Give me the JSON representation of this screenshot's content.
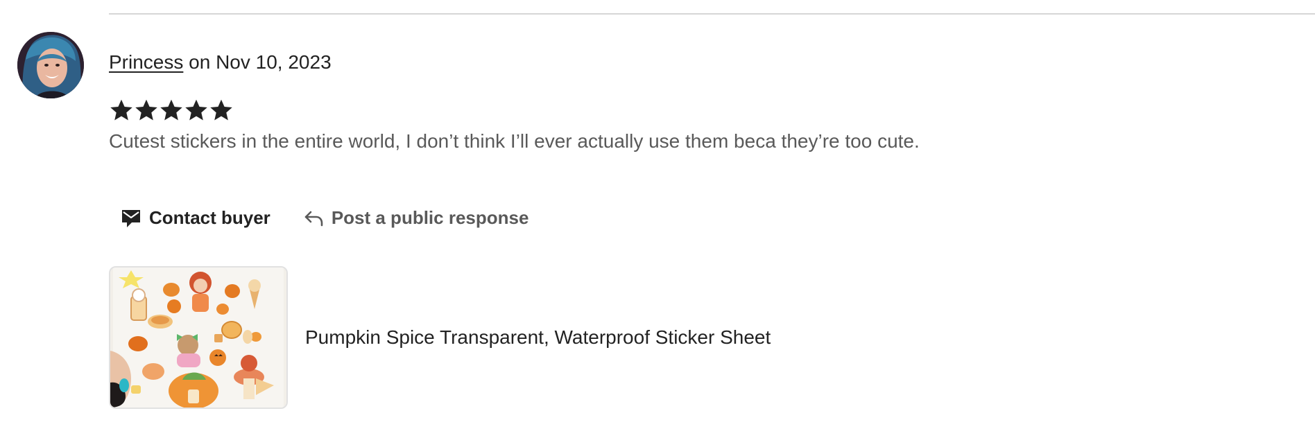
{
  "review": {
    "reviewer_name": "Princess",
    "date_prefix": " on ",
    "date": "Nov 10, 2023",
    "rating": 5,
    "rating_max": 5,
    "text": "Cutest stickers in the entire world, I don’t think I’ll ever actually use them beca they’re too cute."
  },
  "actions": {
    "contact_label": "Contact buyer",
    "contact_icon": "envelope-icon",
    "respond_label": "Post a public response",
    "respond_icon": "reply-arrow-icon"
  },
  "product": {
    "title": "Pumpkin Spice Transparent, Waterproof Sticker Sheet"
  },
  "colors": {
    "primary_text": "#222222",
    "secondary_text": "#595959",
    "divider": "#d6d6d6",
    "star": "#222222"
  }
}
